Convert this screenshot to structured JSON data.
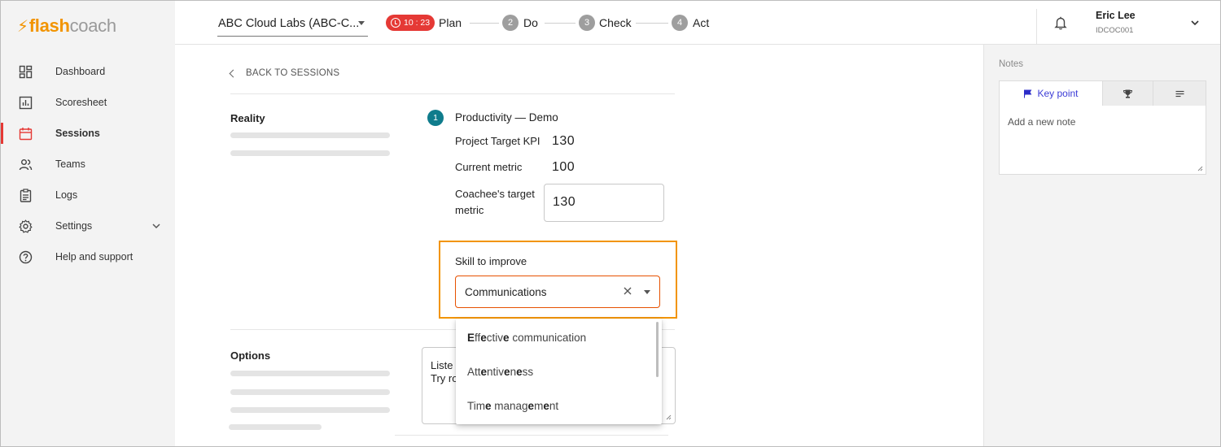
{
  "brand": {
    "flash": "flash",
    "coach": "coach",
    "accent": "#f29400"
  },
  "sidebar": {
    "items": [
      {
        "label": "Dashboard",
        "icon": "dashboard-icon"
      },
      {
        "label": "Scoresheet",
        "icon": "chart-icon"
      },
      {
        "label": "Sessions",
        "icon": "calendar-icon",
        "active": true
      },
      {
        "label": "Teams",
        "icon": "people-icon"
      },
      {
        "label": "Logs",
        "icon": "clipboard-icon"
      },
      {
        "label": "Settings",
        "icon": "gear-icon"
      },
      {
        "label": "Help and support",
        "icon": "help-icon"
      }
    ]
  },
  "header": {
    "org_select": "ABC Cloud Labs (ABC-C...",
    "timer": "10 : 23",
    "steps": [
      {
        "label": "Plan"
      },
      {
        "num": "2",
        "label": "Do"
      },
      {
        "num": "3",
        "label": "Check"
      },
      {
        "num": "4",
        "label": "Act"
      }
    ],
    "user": {
      "name": "Eric Lee",
      "id": "IDCOC001"
    }
  },
  "main": {
    "back_label": "BACK TO SESSIONS",
    "reality": {
      "title": "Reality",
      "badge": "1",
      "kpi_name": "Productivity",
      "kpi_dash": " — ",
      "kpi_suffix": "Demo",
      "project_target_label": "Project Target KPI",
      "project_target_value": "130",
      "current_metric_label": "Current metric",
      "current_metric_value": "100",
      "coachee_target_label_1": "Coachee's target",
      "coachee_target_label_2": "metric",
      "coachee_target_value": "130",
      "skill_label": "Skill to improve",
      "skill_value": "Communications"
    },
    "options": {
      "title": "Options",
      "text_line1": "Liste",
      "text_line2": "Try ro"
    },
    "dropdown": [
      {
        "parts": [
          [
            "E",
            true
          ],
          [
            "ff",
            false
          ],
          [
            "e",
            true
          ],
          [
            "cti",
            false
          ],
          [
            "v",
            false
          ],
          [
            "e",
            true
          ],
          [
            " communication",
            false
          ]
        ]
      },
      {
        "parts": [
          [
            "Att",
            false
          ],
          [
            "e",
            true
          ],
          [
            "ntiv",
            false
          ],
          [
            "e",
            true
          ],
          [
            "n",
            false
          ],
          [
            "e",
            true
          ],
          [
            "ss",
            false
          ]
        ]
      },
      {
        "parts": [
          [
            "Tim",
            false
          ],
          [
            "e",
            true
          ],
          [
            " manag",
            false
          ],
          [
            "e",
            true
          ],
          [
            "m",
            false
          ],
          [
            "e",
            true
          ],
          [
            "nt",
            false
          ]
        ]
      }
    ]
  },
  "notes": {
    "title": "Notes",
    "tabs": [
      "Key point"
    ],
    "placeholder": "Add a new note"
  },
  "colors": {
    "danger": "#e53935",
    "teal": "#0f7c8c",
    "orange_highlight": "#f29400",
    "select_border": "#e65100",
    "tab_active": "#3c3cd6"
  }
}
